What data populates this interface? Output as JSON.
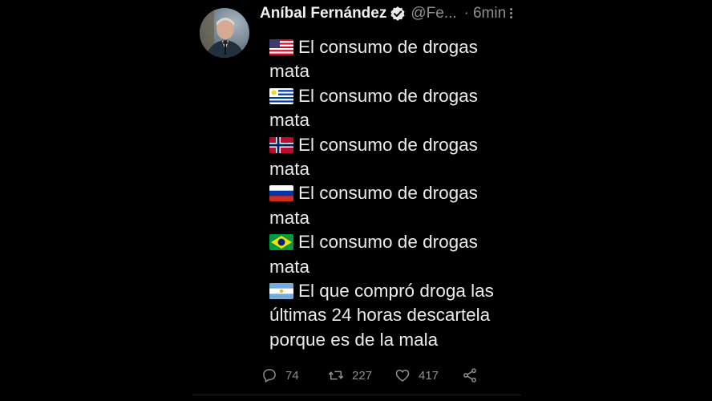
{
  "author": {
    "name": "Aníbal Fernández",
    "handle": "@Fe...",
    "separator": "·",
    "time": "6min"
  },
  "tweet_lines": [
    {
      "flag": "usa-flag-icon",
      "text": "El consumo de drogas"
    },
    {
      "flag": null,
      "text": "mata"
    },
    {
      "flag": "uruguay-flag-icon",
      "text": "El consumo de drogas"
    },
    {
      "flag": null,
      "text": "mata"
    },
    {
      "flag": "norway-flag-icon",
      "text": "El consumo de drogas"
    },
    {
      "flag": null,
      "text": "mata"
    },
    {
      "flag": "russia-flag-icon",
      "text": "El consumo de drogas"
    },
    {
      "flag": null,
      "text": "mata"
    },
    {
      "flag": "brazil-flag-icon",
      "text": "El consumo de drogas"
    },
    {
      "flag": null,
      "text": "mata"
    },
    {
      "flag": "argentina-flag-icon",
      "text": "El que compró droga las"
    },
    {
      "flag": null,
      "text": "últimas 24 horas descartela"
    },
    {
      "flag": null,
      "text": "porque es de la mala"
    }
  ],
  "actions": {
    "replies": "74",
    "retweets": "227",
    "likes": "417"
  },
  "colors": {
    "background": "#000000",
    "text": "#e7e9ea",
    "muted": "#8b9197"
  }
}
